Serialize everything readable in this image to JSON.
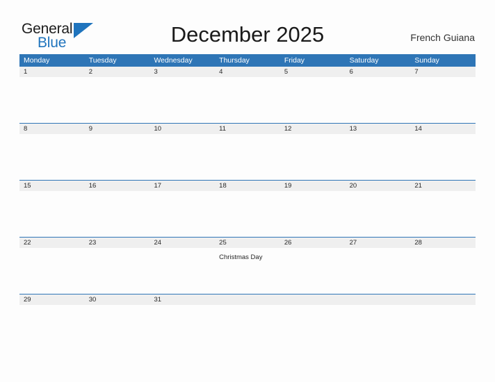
{
  "brand": {
    "name_part1": "General",
    "name_part2": "Blue",
    "flag_icon": "blue-triangle-flag-icon"
  },
  "header": {
    "title": "December 2025",
    "region": "French Guiana"
  },
  "colors": {
    "header_blue": "#2E75B6",
    "brand_blue": "#1F74BD",
    "date_band_gray": "#EFEFEF",
    "page_background": "#FDFDFD",
    "text": "#262626"
  },
  "calendar": {
    "month": "December",
    "year": "2025",
    "day_headers": [
      "Monday",
      "Tuesday",
      "Wednesday",
      "Thursday",
      "Friday",
      "Saturday",
      "Sunday"
    ],
    "weeks": [
      {
        "days": [
          {
            "date": "1",
            "event": ""
          },
          {
            "date": "2",
            "event": ""
          },
          {
            "date": "3",
            "event": ""
          },
          {
            "date": "4",
            "event": ""
          },
          {
            "date": "5",
            "event": ""
          },
          {
            "date": "6",
            "event": ""
          },
          {
            "date": "7",
            "event": ""
          }
        ]
      },
      {
        "days": [
          {
            "date": "8",
            "event": ""
          },
          {
            "date": "9",
            "event": ""
          },
          {
            "date": "10",
            "event": ""
          },
          {
            "date": "11",
            "event": ""
          },
          {
            "date": "12",
            "event": ""
          },
          {
            "date": "13",
            "event": ""
          },
          {
            "date": "14",
            "event": ""
          }
        ]
      },
      {
        "days": [
          {
            "date": "15",
            "event": ""
          },
          {
            "date": "16",
            "event": ""
          },
          {
            "date": "17",
            "event": ""
          },
          {
            "date": "18",
            "event": ""
          },
          {
            "date": "19",
            "event": ""
          },
          {
            "date": "20",
            "event": ""
          },
          {
            "date": "21",
            "event": ""
          }
        ]
      },
      {
        "days": [
          {
            "date": "22",
            "event": ""
          },
          {
            "date": "23",
            "event": ""
          },
          {
            "date": "24",
            "event": ""
          },
          {
            "date": "25",
            "event": "Christmas Day"
          },
          {
            "date": "26",
            "event": ""
          },
          {
            "date": "27",
            "event": ""
          },
          {
            "date": "28",
            "event": ""
          }
        ]
      },
      {
        "days": [
          {
            "date": "29",
            "event": ""
          },
          {
            "date": "30",
            "event": ""
          },
          {
            "date": "31",
            "event": ""
          },
          {
            "date": "",
            "event": ""
          },
          {
            "date": "",
            "event": ""
          },
          {
            "date": "",
            "event": ""
          },
          {
            "date": "",
            "event": ""
          }
        ]
      }
    ]
  }
}
